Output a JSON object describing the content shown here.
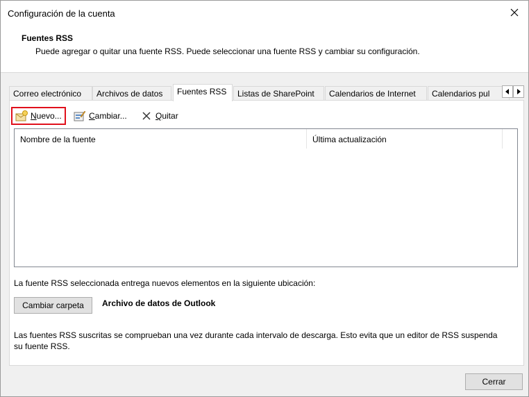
{
  "window": {
    "title": "Configuración de la cuenta"
  },
  "header": {
    "heading": "Fuentes RSS",
    "description": "Puede agregar o quitar una fuente RSS. Puede seleccionar una fuente RSS y cambiar su configuración."
  },
  "tabs": [
    {
      "label": "Correo electrónico"
    },
    {
      "label": "Archivos de datos"
    },
    {
      "label": "Fuentes RSS"
    },
    {
      "label": "Listas de SharePoint"
    },
    {
      "label": "Calendarios de Internet"
    },
    {
      "label": "Calendarios pul"
    }
  ],
  "toolbar": {
    "new_label_u": "N",
    "new_label_rest": "uevo...",
    "change_label_u": "C",
    "change_label_rest": "ambiar...",
    "remove_label_u": "Q",
    "remove_label_rest": "uitar"
  },
  "list": {
    "columns": [
      {
        "label": "Nombre de la fuente"
      },
      {
        "label": "Última actualización"
      }
    ]
  },
  "location": {
    "text": "La fuente RSS seleccionada entrega nuevos elementos en la siguiente ubicación:",
    "change_folder_label": "Cambiar carpeta",
    "folder_name": "Archivo de datos de Outlook"
  },
  "note": "Las fuentes RSS suscritas se comprueban una vez durante cada intervalo de descarga. Esto evita que un editor de RSS suspenda su fuente RSS.",
  "footer": {
    "close_label": "Cerrar"
  },
  "colors": {
    "highlight": "#e0101b",
    "panel_border": "#d9d9d9"
  },
  "icons": [
    "close-icon",
    "new-feed-icon",
    "change-feed-icon",
    "remove-icon",
    "arrow-left-icon",
    "arrow-right-icon"
  ]
}
